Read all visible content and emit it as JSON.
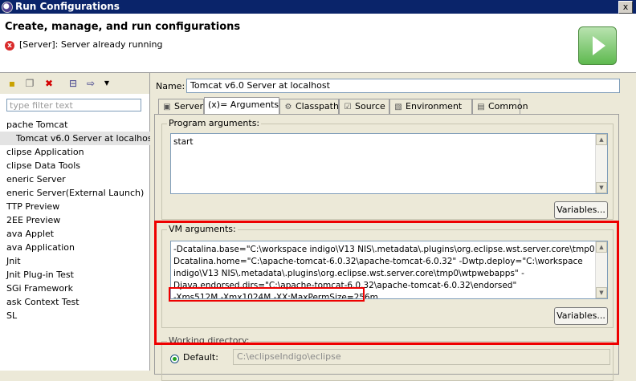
{
  "window": {
    "title": "Run Configurations",
    "close_glyph": "x"
  },
  "header": {
    "title": "Create, manage, and run configurations",
    "message": "[Server]: Server already running",
    "error_glyph": "x"
  },
  "toolbar": {
    "icons": [
      "new-config-icon",
      "duplicate-icon",
      "delete-icon",
      "collapse-all-icon",
      "filter-icon",
      "dropdown-arrow-icon"
    ]
  },
  "filter": {
    "placeholder": "type filter text"
  },
  "tree": {
    "items": [
      {
        "label": "pache Tomcat",
        "indent": 0,
        "selected": false
      },
      {
        "label": "Tomcat v6.0 Server at localhost",
        "indent": 1,
        "selected": true
      },
      {
        "label": "clipse Application",
        "indent": 0,
        "selected": false
      },
      {
        "label": "clipse Data Tools",
        "indent": 0,
        "selected": false
      },
      {
        "label": "eneric Server",
        "indent": 0,
        "selected": false
      },
      {
        "label": "eneric Server(External Launch)",
        "indent": 0,
        "selected": false
      },
      {
        "label": "TTP Preview",
        "indent": 0,
        "selected": false
      },
      {
        "label": "2EE Preview",
        "indent": 0,
        "selected": false
      },
      {
        "label": "ava Applet",
        "indent": 0,
        "selected": false
      },
      {
        "label": "ava Application",
        "indent": 0,
        "selected": false
      },
      {
        "label": "Jnit",
        "indent": 0,
        "selected": false
      },
      {
        "label": "Jnit Plug-in Test",
        "indent": 0,
        "selected": false
      },
      {
        "label": "SGi Framework",
        "indent": 0,
        "selected": false
      },
      {
        "label": "ask Context Test",
        "indent": 0,
        "selected": false
      },
      {
        "label": "SL",
        "indent": 0,
        "selected": false
      }
    ]
  },
  "config": {
    "name_label": "Name:",
    "name_value": "Tomcat v6.0 Server at localhost",
    "tabs": [
      {
        "label": "Server",
        "icon": "server-icon",
        "active": false
      },
      {
        "label": "(x)= Arguments",
        "icon": "",
        "active": true
      },
      {
        "label": "Classpath",
        "icon": "classpath-icon",
        "active": false
      },
      {
        "label": "Source",
        "icon": "source-icon",
        "active": false
      },
      {
        "label": "Environment",
        "icon": "environment-icon",
        "active": false
      },
      {
        "label": "Common",
        "icon": "common-icon",
        "active": false
      }
    ],
    "program_args": {
      "label": "Program arguments:",
      "value": "start",
      "variables_button": "Variables..."
    },
    "vm_args": {
      "label": "VM arguments:",
      "lines": [
        "-Dcatalina.base=\"C:\\workspace indigo\\V13 NIS\\.metadata\\.plugins\\org.eclipse.wst.server.core\\tmp0\" -",
        "Dcatalina.home=\"C:\\apache-tomcat-6.0.32\\apache-tomcat-6.0.32\" -Dwtp.deploy=\"C:\\workspace",
        "indigo\\V13 NIS\\.metadata\\.plugins\\org.eclipse.wst.server.core\\tmp0\\wtpwebapps\" -",
        "Djava.endorsed.dirs=\"C:\\apache-tomcat-6.0.32\\apache-tomcat-6.0.32\\endorsed\"",
        "-Xms512M -Xmx1024M -XX:MaxPermSize=256m"
      ],
      "variables_button": "Variables..."
    },
    "working_dir": {
      "label": "Working directory:",
      "default_label": "Default:",
      "default_value": "C:\\eclipseIndigo\\eclipse"
    }
  },
  "highlight_color": "#e00000"
}
